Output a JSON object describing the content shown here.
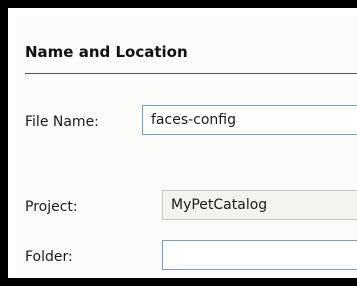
{
  "section": {
    "title": "Name and Location"
  },
  "fields": {
    "file_name": {
      "label": "File Name:",
      "value": "faces-config"
    },
    "project": {
      "label": "Project:",
      "value": "MyPetCatalog"
    },
    "folder": {
      "label": "Folder:",
      "value": ""
    }
  }
}
